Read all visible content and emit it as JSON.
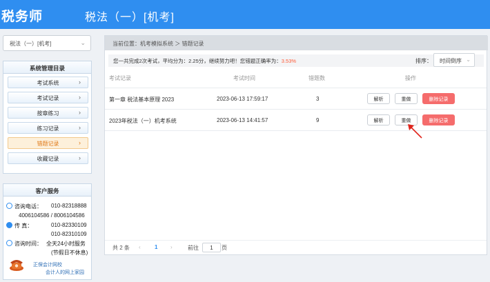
{
  "header": {
    "logo": "税务师",
    "exam_title": "税法（一）[机考]"
  },
  "sidebar": {
    "subject_select": "税法（一）[机考]",
    "menu_title": "系统管理目录",
    "menu_items": [
      {
        "label": "考试系统"
      },
      {
        "label": "考试记录"
      },
      {
        "label": "按章练习"
      },
      {
        "label": "练习记录"
      },
      {
        "label": "错题记录",
        "active": true
      },
      {
        "label": "收藏记录"
      }
    ],
    "service": {
      "title": "客户服务",
      "consult_label": "咨询电话：",
      "consult_phone": "010-82318888",
      "consult_phone2": "4006104586 / 8006104586",
      "fax_label": "传    真：",
      "fax1": "010-82330109",
      "fax2": "010-82310109",
      "hours_label": "咨询时间：",
      "hours": "全天24小时服务",
      "hours_note": "(节假日不休息)",
      "footer1": "正保会计网校",
      "footer2": "会计人的网上家园"
    }
  },
  "main": {
    "breadcrumb": "当前位置：机考模拟系统 ＞ 错题记录",
    "summary_prefix": "您一共完成2次考试，平均分为：2.25分，继续努力吧！您错题正确率为：",
    "summary_rate": "3.53%",
    "sort_label": "排序：",
    "sort_value": "时间倒序",
    "columns": [
      "考试记录",
      "考试时间",
      "错题数",
      "操作"
    ],
    "rows": [
      {
        "record": "第一章 税法基本原理 2023",
        "time": "2023-06-13 17:59:17",
        "errors": "3"
      },
      {
        "record": "2023年税法（一）机考系统",
        "time": "2023-06-13 14:41:57",
        "errors": "9"
      }
    ],
    "actions": {
      "analyze": "解析",
      "redo": "重做",
      "delete": "删除记录"
    },
    "pager": {
      "total": "共 2 条",
      "prev": "‹",
      "current": "1",
      "next": "›",
      "goto": "前往",
      "page_input": "1",
      "page_unit": "页"
    }
  },
  "colors": {
    "brand": "#2f8ef0",
    "danger": "#f56c6c",
    "active": "#e07a1a",
    "annotation_arrow": "#e0241b"
  }
}
